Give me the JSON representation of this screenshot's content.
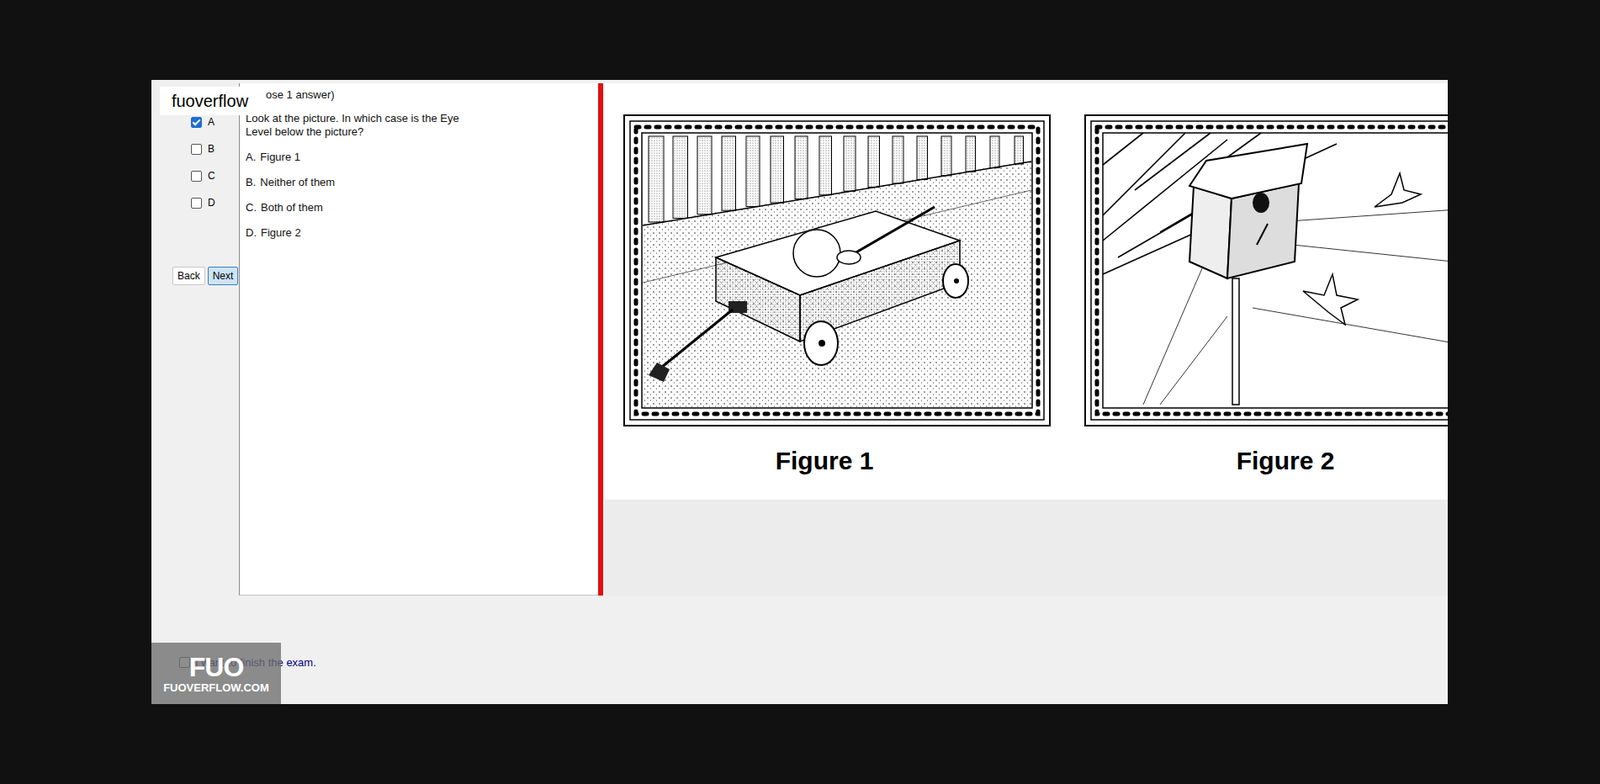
{
  "brand": {
    "label": "fuoverflow"
  },
  "answer_options": [
    {
      "label": "A",
      "checked": true
    },
    {
      "label": "B",
      "checked": false
    },
    {
      "label": "C",
      "checked": false
    },
    {
      "label": "D",
      "checked": false
    }
  ],
  "nav_buttons": [
    {
      "label": "Back",
      "selected": false
    },
    {
      "label": "Next",
      "selected": true
    }
  ],
  "question": {
    "instruction": "ose 1 answer)",
    "text": "Look at the picture. In which case is the Eye Level below the picture?",
    "choices": [
      {
        "letter": "A.",
        "text": "Figure 1"
      },
      {
        "letter": "B.",
        "text": "Neither of them"
      },
      {
        "letter": "C.",
        "text": "Both of them"
      },
      {
        "letter": "D.",
        "text": "Figure 2"
      }
    ]
  },
  "figures": [
    {
      "caption": "Figure 1"
    },
    {
      "caption": "Figure 2"
    }
  ],
  "finish": {
    "label": "I want to finish the exam.",
    "checked": false
  },
  "logo": {
    "mark": "FUO",
    "site": "FUOVERFLOW.COM"
  }
}
